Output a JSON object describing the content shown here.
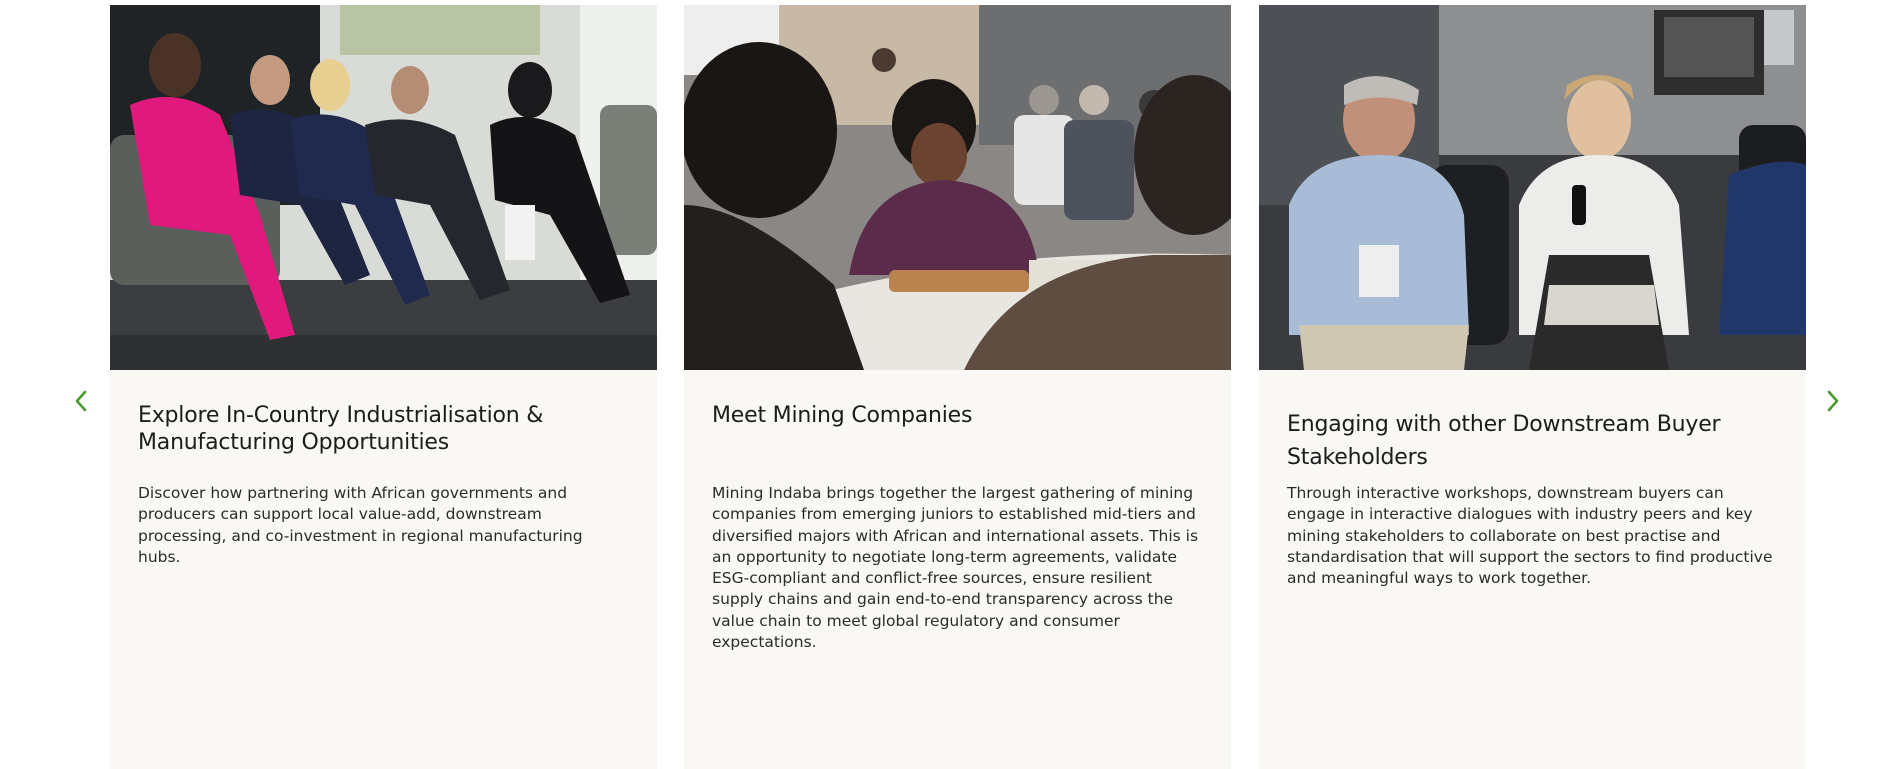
{
  "carousel": {
    "prev_icon": "chevron-left-icon",
    "next_icon": "chevron-right-icon",
    "accent_color": "#4a9a2e",
    "card_background": "#f9f8f4",
    "cards": [
      {
        "image": "panel-discussion-photo",
        "title": "Explore In-Country Industrialisation & Manufacturing Opportunities",
        "text": "Discover how partnering with African governments and producers can support local value-add, downstream processing, and co-investment in regional manufacturing hubs."
      },
      {
        "image": "roundtable-meeting-photo",
        "title": "Meet Mining Companies",
        "text": "Mining Indaba brings together the largest gathering of mining companies from emerging juniors to established mid-tiers and diversified majors with African and international assets. This is an opportunity to negotiate long-term agreements, validate ESG-compliant and conflict-free sources, ensure resilient supply chains and gain end-to-end transparency across the value chain to meet global regulatory and consumer expectations."
      },
      {
        "image": "workshop-dialogue-photo",
        "title": "Engaging with other Downstream Buyer Stakeholders",
        "text": "Through interactive workshops, downstream buyers can engage in interactive dialogues with industry peers and key mining stakeholders to collaborate on best practise and standardisation that will support the sectors to find productive and meaningful ways to work together."
      }
    ]
  }
}
